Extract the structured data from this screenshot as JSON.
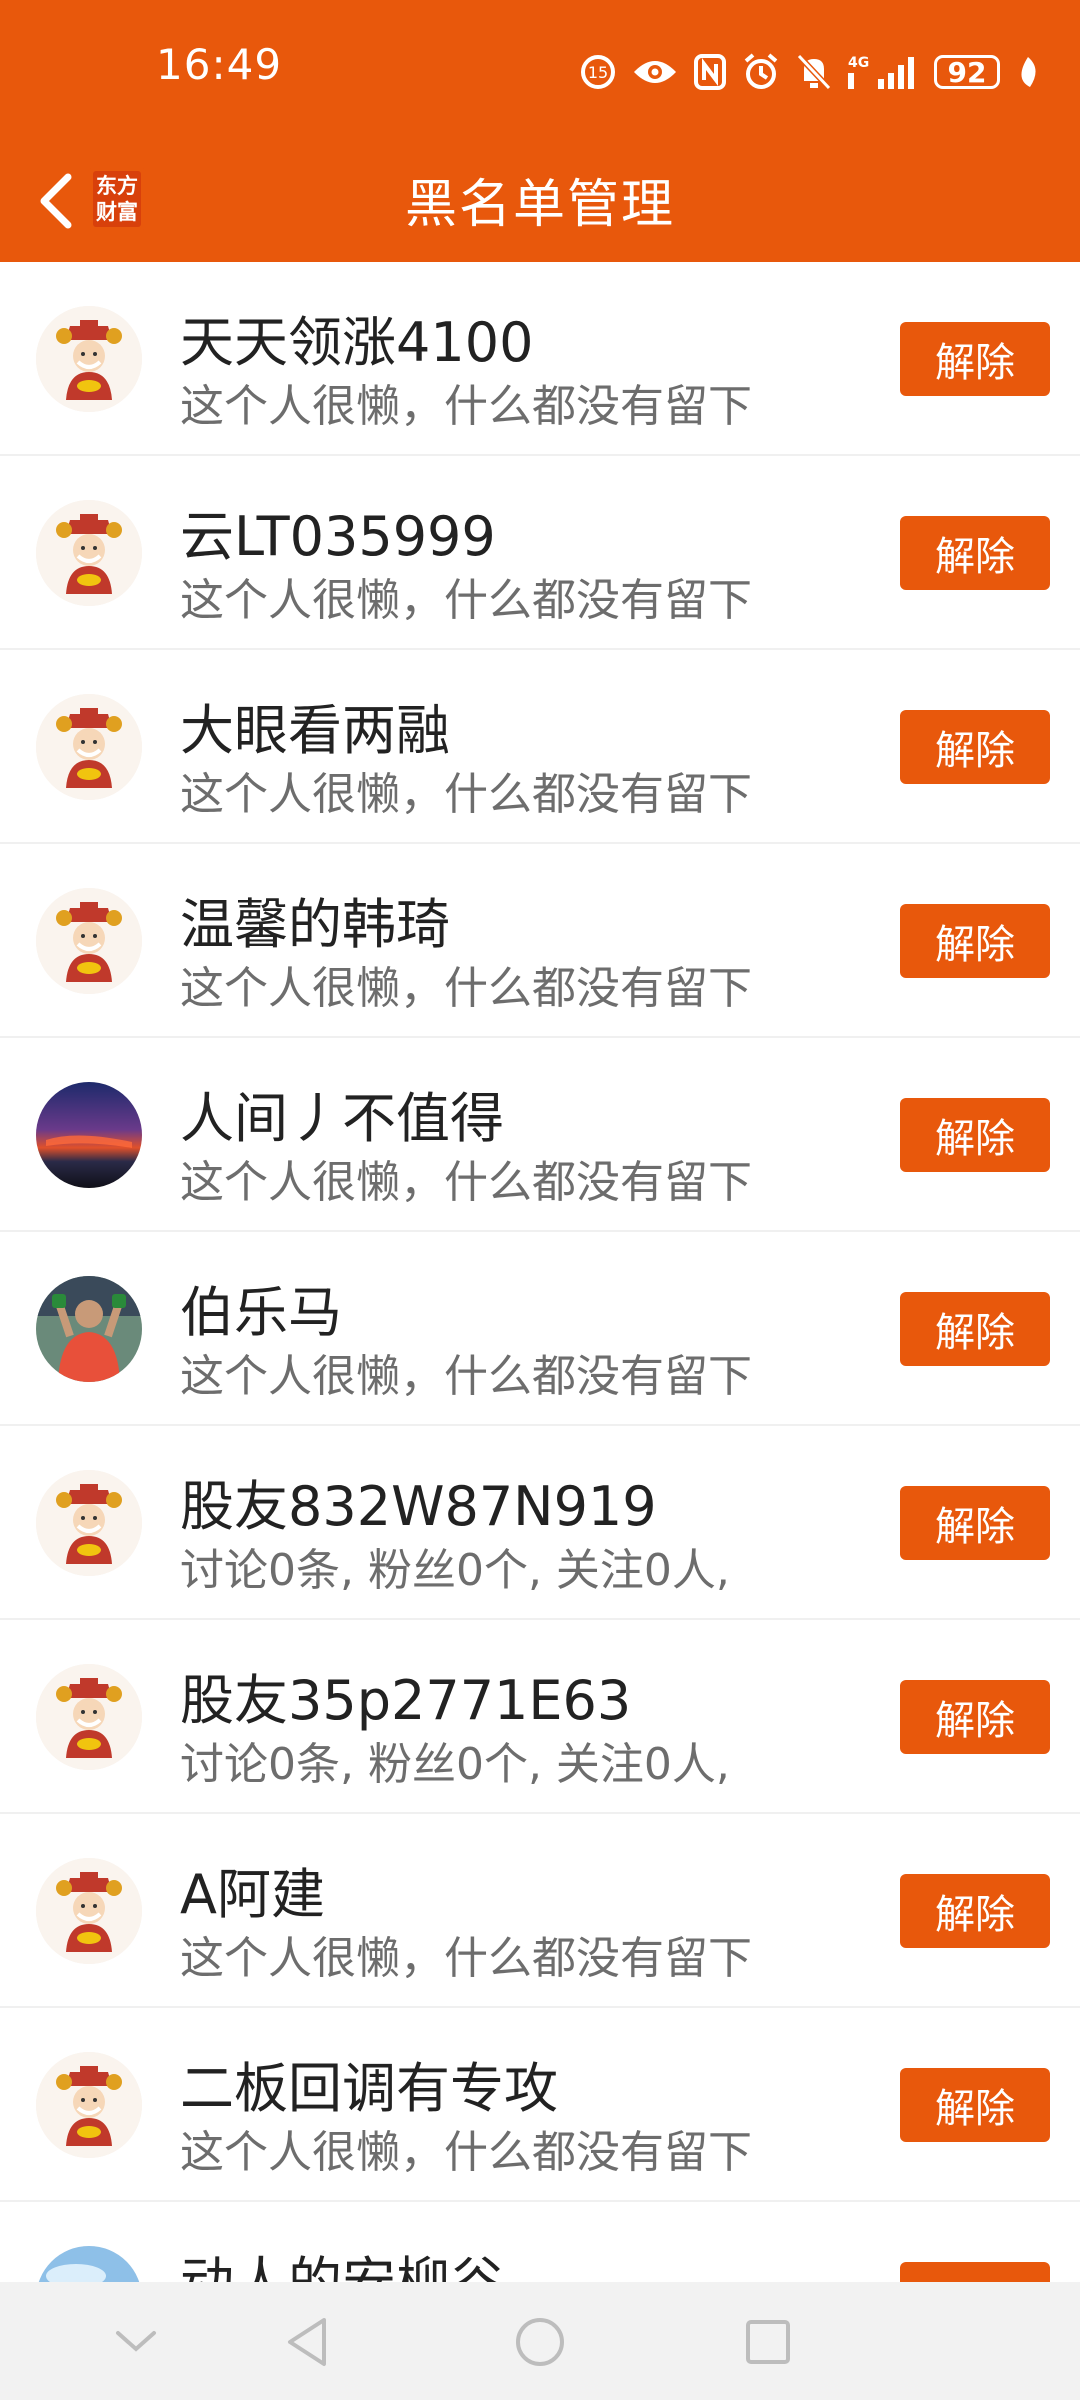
{
  "status_bar": {
    "time": "16:49",
    "battery": "92",
    "network": "4G"
  },
  "header": {
    "title": "黑名单管理",
    "logo_line1": "东方",
    "logo_line2": "财富"
  },
  "colors": {
    "accent": "#E8580C"
  },
  "button_label": "解除",
  "items": [
    {
      "name": "天天领涨4100",
      "desc": "这个人很懒，什么都没有留下",
      "avatar": "caishen"
    },
    {
      "name": "云LT035999",
      "desc": "这个人很懒，什么都没有留下",
      "avatar": "caishen"
    },
    {
      "name": "大眼看两融",
      "desc": "这个人很懒，什么都没有留下",
      "avatar": "caishen"
    },
    {
      "name": "温馨的韩琦",
      "desc": "这个人很懒，什么都没有留下",
      "avatar": "caishen"
    },
    {
      "name": "人间丿不值得",
      "desc": "这个人很懒，什么都没有留下",
      "avatar": "sunset-photo"
    },
    {
      "name": "伯乐马",
      "desc": "这个人很懒，什么都没有留下",
      "avatar": "player-photo"
    },
    {
      "name": "股友832W87N919",
      "desc": "讨论0条, 粉丝0个, 关注0人,",
      "avatar": "caishen"
    },
    {
      "name": "股友35p2771E63",
      "desc": "讨论0条, 粉丝0个, 关注0人,",
      "avatar": "caishen"
    },
    {
      "name": "A阿建",
      "desc": "这个人很懒，什么都没有留下",
      "avatar": "caishen"
    },
    {
      "name": "二板回调有专攻",
      "desc": "这个人很懒，什么都没有留下",
      "avatar": "caishen"
    },
    {
      "name": "动人的安柳谷",
      "desc": "",
      "avatar": "sky-photo"
    }
  ]
}
